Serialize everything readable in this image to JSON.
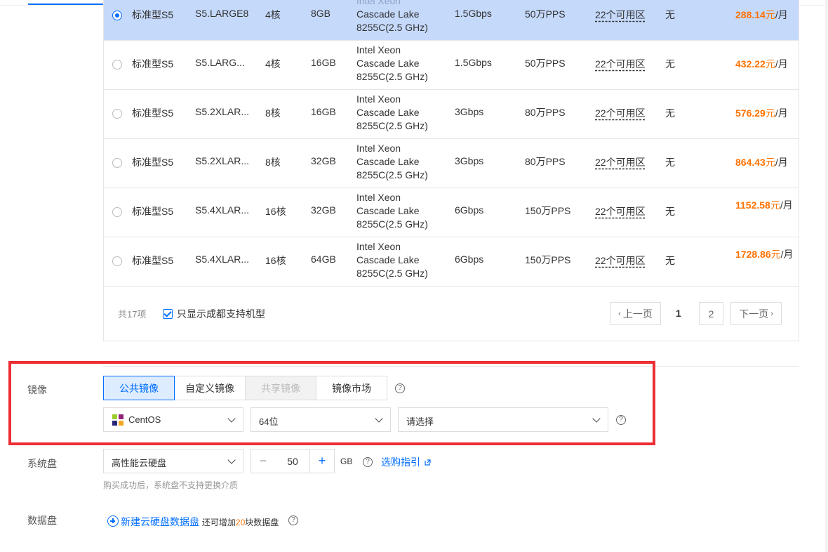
{
  "instance_table": {
    "rows": [
      {
        "type": "标准型S5",
        "model": "S5.LARGE8",
        "cpu": "4核",
        "memory": "8GB",
        "processor_l1": "Intel Xeon",
        "processor_l2": "Cascade Lake",
        "processor_l3": "8255C(2.5 GHz)",
        "bandwidth": "1.5Gbps",
        "pps": "50万PPS",
        "zones": "22个可用区",
        "extra": "无",
        "price": "288.14",
        "price_unit": "元",
        "price_period": "/月",
        "selected": true
      },
      {
        "type": "标准型S5",
        "model": "S5.LARG...",
        "cpu": "4核",
        "memory": "16GB",
        "processor_l1": "Intel Xeon",
        "processor_l2": "Cascade Lake",
        "processor_l3": "8255C(2.5 GHz)",
        "bandwidth": "1.5Gbps",
        "pps": "50万PPS",
        "zones": "22个可用区",
        "extra": "无",
        "price": "432.22",
        "price_unit": "元",
        "price_period": "/月",
        "selected": false
      },
      {
        "type": "标准型S5",
        "model": "S5.2XLAR...",
        "cpu": "8核",
        "memory": "16GB",
        "processor_l1": "Intel Xeon",
        "processor_l2": "Cascade Lake",
        "processor_l3": "8255C(2.5 GHz)",
        "bandwidth": "3Gbps",
        "pps": "80万PPS",
        "zones": "22个可用区",
        "extra": "无",
        "price": "576.29",
        "price_unit": "元",
        "price_period": "/月",
        "selected": false
      },
      {
        "type": "标准型S5",
        "model": "S5.2XLAR...",
        "cpu": "8核",
        "memory": "32GB",
        "processor_l1": "Intel Xeon",
        "processor_l2": "Cascade Lake",
        "processor_l3": "8255C(2.5 GHz)",
        "bandwidth": "3Gbps",
        "pps": "80万PPS",
        "zones": "22个可用区",
        "extra": "无",
        "price": "864.43",
        "price_unit": "元",
        "price_period": "/月",
        "selected": false
      },
      {
        "type": "标准型S5",
        "model": "S5.4XLAR...",
        "cpu": "16核",
        "memory": "32GB",
        "processor_l1": "Intel Xeon",
        "processor_l2": "Cascade Lake",
        "processor_l3": "8255C(2.5 GHz)",
        "bandwidth": "6Gbps",
        "pps": "150万PPS",
        "zones": "22个可用区",
        "extra": "无",
        "price": "1152.58",
        "price_unit": "元",
        "price_period": "/月",
        "selected": false
      },
      {
        "type": "标准型S5",
        "model": "S5.4XLAR...",
        "cpu": "16核",
        "memory": "64GB",
        "processor_l1": "Intel Xeon",
        "processor_l2": "Cascade Lake",
        "processor_l3": "8255C(2.5 GHz)",
        "bandwidth": "6Gbps",
        "pps": "150万PPS",
        "zones": "22个可用区",
        "extra": "无",
        "price": "1728.86",
        "price_unit": "元",
        "price_period": "/月",
        "selected": false
      }
    ],
    "footer": {
      "total": "共17项",
      "filter_label": "只显示成都支持机型",
      "filter_checked": true,
      "prev": "上一页",
      "page_current": "1",
      "page_2": "2",
      "next": "下一页"
    }
  },
  "image_section": {
    "label": "镜像",
    "tabs": [
      "公共镜像",
      "自定义镜像",
      "共享镜像",
      "镜像市场"
    ],
    "active_tab": "公共镜像",
    "disabled_tab": "共享镜像",
    "os_select": "CentOS",
    "arch_select": "64位",
    "version_placeholder": "请选择"
  },
  "system_disk": {
    "label": "系统盘",
    "type_select": "高性能云硬盘",
    "size": "50",
    "unit": "GB",
    "guide_link": "选购指引",
    "hint": "购买成功后，系统盘不支持更换介质"
  },
  "data_disk": {
    "label": "数据盘",
    "add_link": "新建云硬盘数据盘",
    "remaining_prefix": "还可增加",
    "remaining_count": "20",
    "remaining_suffix": "块数据盘"
  },
  "colors": {
    "accent": "#006eff",
    "price": "#ff7200",
    "highlight_border": "#ed2f35",
    "selected_row": "#c5d9fb"
  }
}
